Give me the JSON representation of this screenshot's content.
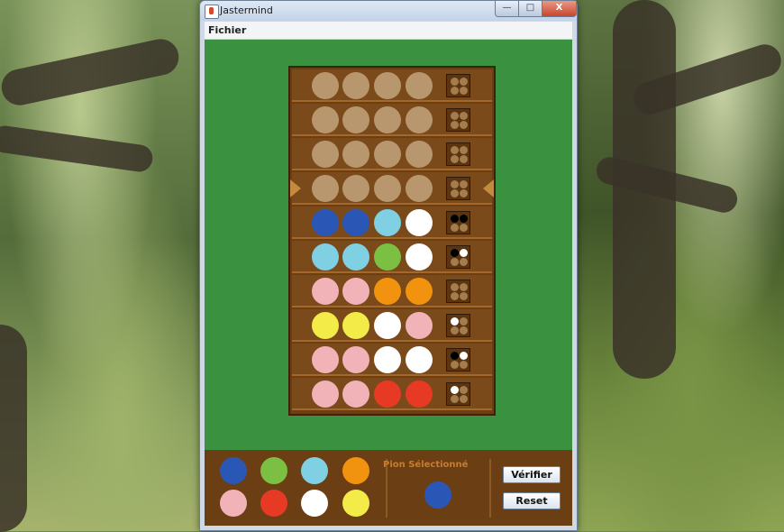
{
  "window": {
    "title": "Jastermind"
  },
  "menu": {
    "fichier": "Fichier"
  },
  "controls": {
    "minimize": "—",
    "maximize": "□",
    "close": "X"
  },
  "colors": {
    "empty": "#b9976e",
    "blue": "#2a57b6",
    "cyan": "#7fd0e2",
    "white": "#ffffff",
    "green": "#7cc043",
    "pink": "#f1b2b8",
    "orange": "#f1930f",
    "yellow": "#f3ec48",
    "red": "#e63a25",
    "hint_empty": "#a57c4b",
    "hint_black": "#000000",
    "hint_white": "#ffffff"
  },
  "board": {
    "active_row": 3,
    "rows": [
      {
        "pegs": [
          "empty",
          "empty",
          "empty",
          "empty"
        ],
        "hints": [
          "hint_empty",
          "hint_empty",
          "hint_empty",
          "hint_empty"
        ]
      },
      {
        "pegs": [
          "empty",
          "empty",
          "empty",
          "empty"
        ],
        "hints": [
          "hint_empty",
          "hint_empty",
          "hint_empty",
          "hint_empty"
        ]
      },
      {
        "pegs": [
          "empty",
          "empty",
          "empty",
          "empty"
        ],
        "hints": [
          "hint_empty",
          "hint_empty",
          "hint_empty",
          "hint_empty"
        ]
      },
      {
        "pegs": [
          "empty",
          "empty",
          "empty",
          "empty"
        ],
        "hints": [
          "hint_empty",
          "hint_empty",
          "hint_empty",
          "hint_empty"
        ]
      },
      {
        "pegs": [
          "blue",
          "blue",
          "cyan",
          "white"
        ],
        "hints": [
          "hint_black",
          "hint_black",
          "hint_empty",
          "hint_empty"
        ]
      },
      {
        "pegs": [
          "cyan",
          "cyan",
          "green",
          "white"
        ],
        "hints": [
          "hint_black",
          "hint_white",
          "hint_empty",
          "hint_empty"
        ]
      },
      {
        "pegs": [
          "pink",
          "pink",
          "orange",
          "orange"
        ],
        "hints": [
          "hint_empty",
          "hint_empty",
          "hint_empty",
          "hint_empty"
        ]
      },
      {
        "pegs": [
          "yellow",
          "yellow",
          "white",
          "pink"
        ],
        "hints": [
          "hint_white",
          "hint_empty",
          "hint_empty",
          "hint_empty"
        ]
      },
      {
        "pegs": [
          "pink",
          "pink",
          "white",
          "white"
        ],
        "hints": [
          "hint_black",
          "hint_white",
          "hint_empty",
          "hint_empty"
        ]
      },
      {
        "pegs": [
          "pink",
          "pink",
          "red",
          "red"
        ],
        "hints": [
          "hint_white",
          "hint_empty",
          "hint_empty",
          "hint_empty"
        ]
      }
    ]
  },
  "palette": [
    "blue",
    "green",
    "cyan",
    "orange",
    "pink",
    "red",
    "white",
    "yellow"
  ],
  "selection": {
    "label": "Pion Sélectionné",
    "color": "blue"
  },
  "buttons": {
    "verify": "Vérifier",
    "reset": "Reset"
  }
}
